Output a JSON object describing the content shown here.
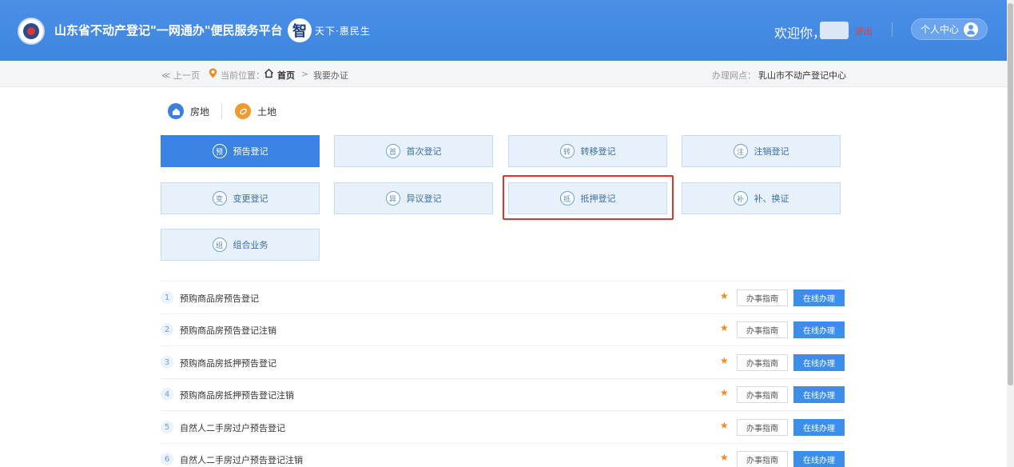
{
  "header": {
    "title": "山东省不动产登记\"一网通办\"便民服务平台",
    "slogan_mark": "智",
    "slogan_text": "天下·惠民生",
    "welcome": "欢迎你，",
    "logout": "退出",
    "personal_center": "个人中心"
  },
  "breadcrumb": {
    "back": "≪ 上一页",
    "location_label": "当前位置：",
    "home": "首页",
    "separator": ">",
    "current": "我要办证",
    "office_label": "办理网点：",
    "office": "乳山市不动产登记中心"
  },
  "categories": [
    {
      "label": "房地",
      "icon": "house-icon"
    },
    {
      "label": "土地",
      "icon": "land-icon"
    }
  ],
  "services": [
    {
      "label": "预告登记",
      "icon_char": "预"
    },
    {
      "label": "首次登记",
      "icon_char": "首"
    },
    {
      "label": "转移登记",
      "icon_char": "转"
    },
    {
      "label": "注销登记",
      "icon_char": "注"
    },
    {
      "label": "变更登记",
      "icon_char": "变"
    },
    {
      "label": "异议登记",
      "icon_char": "异"
    },
    {
      "label": "抵押登记",
      "icon_char": "抵"
    },
    {
      "label": "补、换证",
      "icon_char": "补"
    },
    {
      "label": "组合业务",
      "icon_char": "组"
    }
  ],
  "items": [
    {
      "num": "1",
      "name": "预购商品房预告登记"
    },
    {
      "num": "2",
      "name": "预购商品房预告登记注销"
    },
    {
      "num": "3",
      "name": "预购商品房抵押预告登记"
    },
    {
      "num": "4",
      "name": "预购商品房抵押预告登记注销"
    },
    {
      "num": "5",
      "name": "自然人二手房过户预告登记"
    },
    {
      "num": "6",
      "name": "自然人二手房过户预告登记注销"
    }
  ],
  "item_actions": {
    "guide": "办事指南",
    "online": "在线办理",
    "star": "★"
  },
  "colors": {
    "header_bg": "#4a8ee6",
    "active_tab": "#3b83e2",
    "highlight": "#e8302b",
    "button_blue": "#3b8eea"
  }
}
